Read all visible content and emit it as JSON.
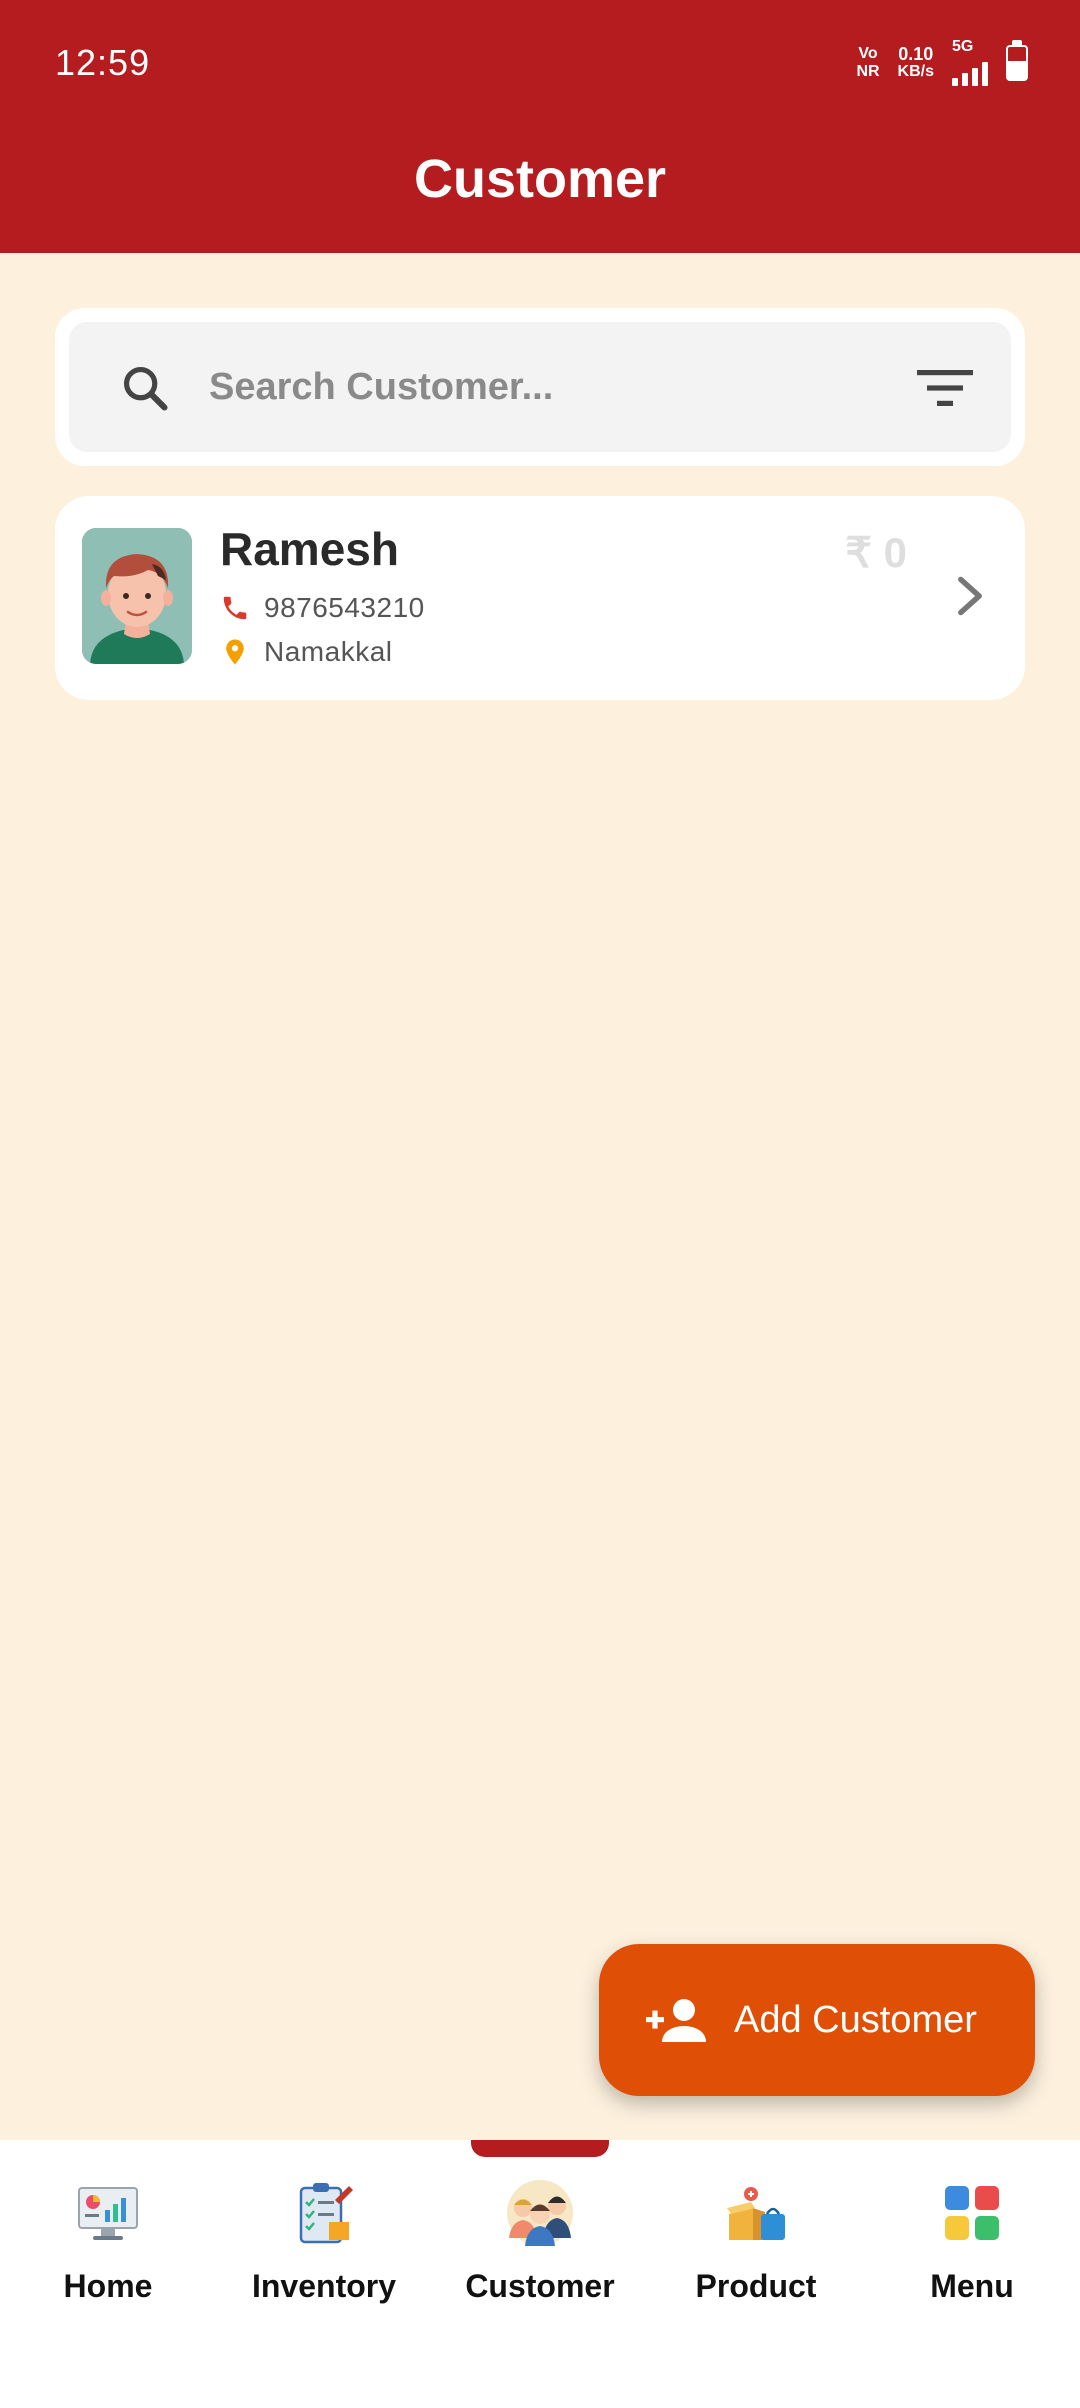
{
  "status_bar": {
    "time": "12:59",
    "network_line1": "Vo",
    "network_line2": "NR",
    "speed_value": "0.10",
    "speed_unit": "KB/s",
    "net_type": "5G"
  },
  "header": {
    "title": "Customer"
  },
  "search": {
    "placeholder": "Search Customer..."
  },
  "customers": [
    {
      "name": "Ramesh",
      "phone": "9876543210",
      "location": "Namakkal",
      "amount": "₹ 0"
    }
  ],
  "fab": {
    "label": "Add Customer"
  },
  "nav": {
    "items": [
      {
        "label": "Home",
        "icon": "dashboard-monitor-icon"
      },
      {
        "label": "Inventory",
        "icon": "clipboard-checklist-icon"
      },
      {
        "label": "Customer",
        "icon": "customer-group-icon",
        "active": true
      },
      {
        "label": "Product",
        "icon": "product-box-icon"
      },
      {
        "label": "Menu",
        "icon": "grid-menu-icon"
      }
    ]
  },
  "colors": {
    "header_bg": "#b41c1f",
    "page_bg": "#fdf1de",
    "fab_bg": "#e04f06",
    "phone_icon": "#d93a2b",
    "location_icon": "#f5a000"
  }
}
